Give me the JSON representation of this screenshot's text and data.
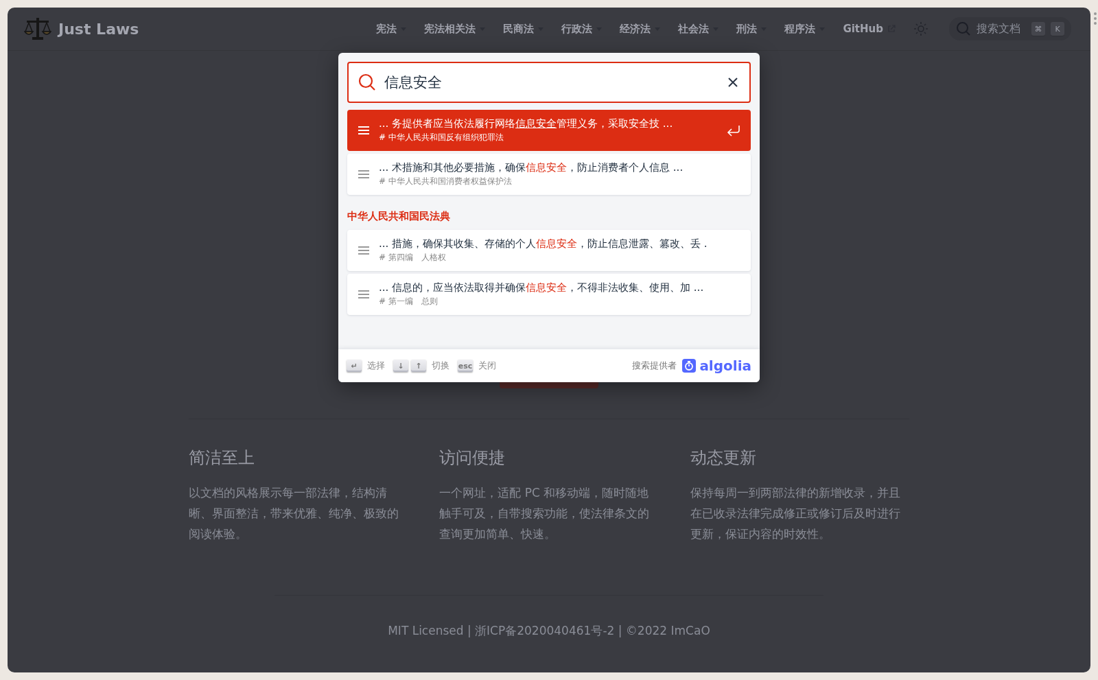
{
  "site": {
    "title": "Just Laws"
  },
  "nav": [
    {
      "label": "宪法",
      "kind": "dropdown"
    },
    {
      "label": "宪法相关法",
      "kind": "dropdown"
    },
    {
      "label": "民商法",
      "kind": "dropdown"
    },
    {
      "label": "行政法",
      "kind": "dropdown"
    },
    {
      "label": "经济法",
      "kind": "dropdown"
    },
    {
      "label": "社会法",
      "kind": "dropdown"
    },
    {
      "label": "刑法",
      "kind": "dropdown"
    },
    {
      "label": "程序法",
      "kind": "dropdown"
    },
    {
      "label": "GitHub",
      "kind": "external"
    }
  ],
  "search_button": {
    "placeholder": "搜索文档",
    "keys": [
      "⌘",
      "K"
    ]
  },
  "search_modal": {
    "query": "信息安全",
    "groups": [
      {
        "results": [
          {
            "text": "... 务提供者应当依法履行网络**信息安全**管理义务，采取安全技 ...",
            "path": "# 中华人民共和国反有组织犯罪法",
            "selected": true
          },
          {
            "text": "... 术措施和其他必要措施，确保**信息安全**，防止消费者个人信息 ...",
            "path": "# 中华人民共和国消费者权益保护法",
            "selected": false
          }
        ]
      },
      {
        "heading": "中华人民共和国民法典",
        "results": [
          {
            "text": "... 措施，确保其收集、存储的个人**信息安全**，防止信息泄露、篡改、丢 .",
            "path": "# 第四编　人格权",
            "selected": false
          },
          {
            "text": "... 信息的，应当依法取得并确保**信息安全**，不得非法收集、使用、加 ...",
            "path": "# 第一编　总则",
            "selected": false
          }
        ]
      }
    ],
    "hints": [
      {
        "keys": [
          "↵"
        ],
        "label": "选择"
      },
      {
        "keys": [
          "↓",
          "↑"
        ],
        "label": "切换"
      },
      {
        "keys": [
          "esc"
        ],
        "label": "关闭"
      }
    ],
    "provider": {
      "label": "搜索提供者",
      "logo": "algolia"
    }
  },
  "features": [
    {
      "title": "简洁至上",
      "text": "以文档的风格展示每一部法律，结构清晰、界面整洁，带来优雅、纯净、极致的阅读体验。"
    },
    {
      "title": "访问便捷",
      "text": "一个网址，适配 PC 和移动端，随时随地触手可及，自带搜索功能，使法律条文的查询更加简单、快速。"
    },
    {
      "title": "动态更新",
      "text": "保持每周一到两部法律的新增收录，并且在已收录法律完成修正或修订后及时进行更新，保证内容的时效性。"
    }
  ],
  "footer": "MIT Licensed | 浙ICP备2020040461号-2 | ©2022 ImCaO"
}
